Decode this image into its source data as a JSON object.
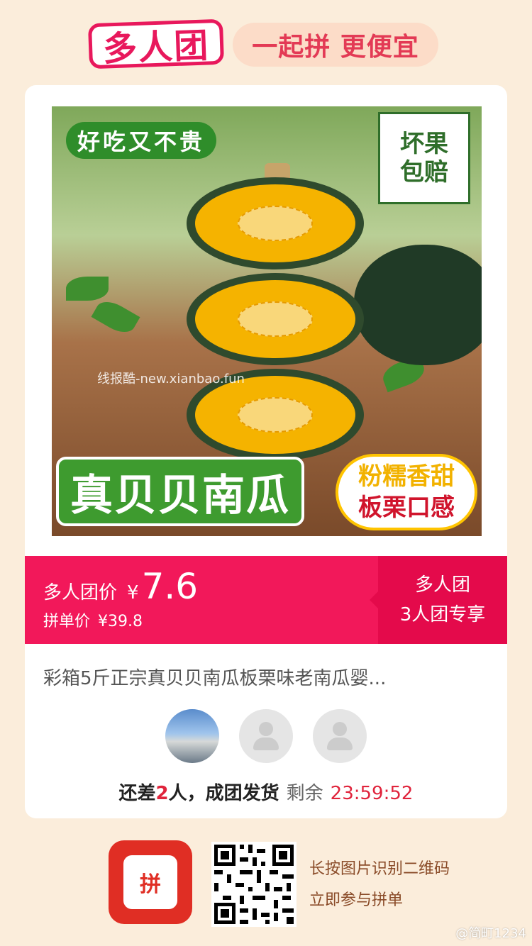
{
  "header": {
    "brand": "多人团",
    "slogan": "一起拼 更便宜"
  },
  "product_image": {
    "tag": "好吃又不贵",
    "guarantee_line1": "坏果",
    "guarantee_line2": "包赔",
    "watermark": "线报酷-new.xianbao.fun",
    "product_name": "真贝贝南瓜",
    "feature_line1": "粉糯香甜",
    "feature_line2": "板栗口感"
  },
  "price": {
    "group_label": "多人团价",
    "currency": "¥",
    "value": "7.6",
    "original_label": "拼单价",
    "original_value": "¥39.8",
    "badge_line1": "多人团",
    "badge_line2": "3人团专享"
  },
  "product_title": "彩箱5斤正宗真贝贝南瓜板栗味老南瓜婴...",
  "status": {
    "prefix": "还差",
    "count": "2",
    "suffix": "人，成团发货",
    "remaining_label": "剩余",
    "timer": "23:59:52"
  },
  "footer": {
    "app_logo_text": "拼",
    "hint_line1": "长按图片识别二维码",
    "hint_line2": "立即参与拼单"
  },
  "weibo_watermark": "@简町1234",
  "colors": {
    "primary_red": "#f2185a",
    "badge_red": "#e40a4b",
    "background": "#fbeddb",
    "app_red": "#e02e24"
  }
}
